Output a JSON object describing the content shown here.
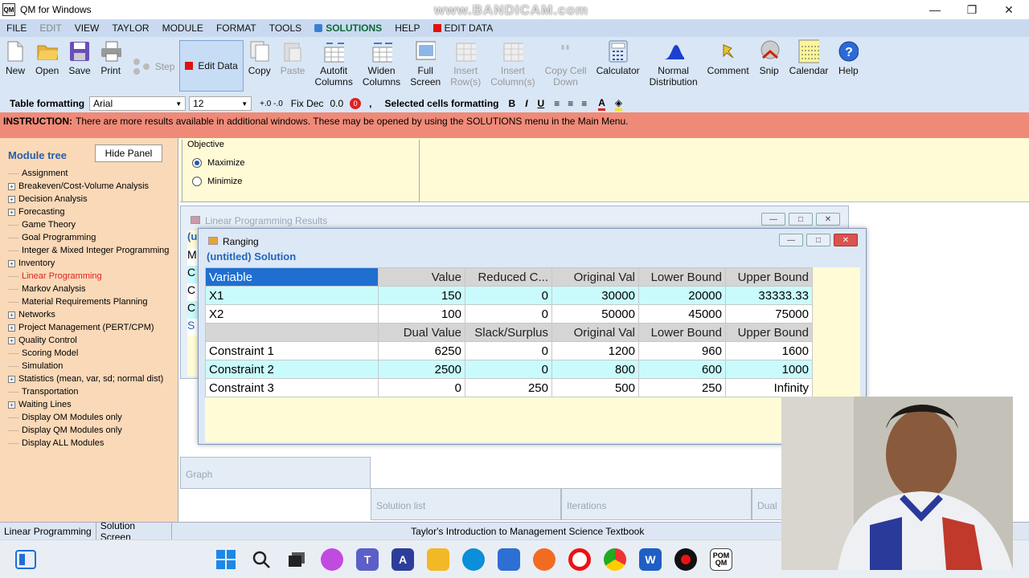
{
  "window": {
    "app_icon": "QM",
    "title": "QM for Windows",
    "watermark": "www.BANDICAM.com"
  },
  "menu": [
    "FILE",
    "EDIT",
    "VIEW",
    "TAYLOR",
    "MODULE",
    "FORMAT",
    "TOOLS",
    "SOLUTIONS",
    "HELP",
    "EDIT DATA"
  ],
  "toolbar": {
    "new": "New",
    "open": "Open",
    "save": "Save",
    "print": "Print",
    "step": "Step",
    "edit_data": "Edit Data",
    "copy": "Copy",
    "paste": "Paste",
    "autofit_1": "Autofit",
    "autofit_2": "Columns",
    "widen_1": "Widen",
    "widen_2": "Columns",
    "full_1": "Full",
    "full_2": "Screen",
    "insrow_1": "Insert",
    "insrow_2": "Row(s)",
    "inscol_1": "Insert",
    "inscol_2": "Column(s)",
    "copycell_1": "Copy Cell",
    "copycell_2": "Down",
    "calculator": "Calculator",
    "normal_1": "Normal",
    "normal_2": "Distribution",
    "comment": "Comment",
    "snip": "Snip",
    "calendar": "Calendar",
    "help": "Help"
  },
  "format": {
    "table_label": "Table formatting",
    "font": "Arial",
    "size": "12",
    "fixdec": "Fix Dec",
    "dec": "0.0",
    "comma": ",",
    "selected_label": "Selected cells formatting",
    "bold": "B",
    "italic": "I",
    "underline": "U"
  },
  "instruction": {
    "label": "INSTRUCTION:",
    "text": "There are more results available in additional windows. These may be opened by using the SOLUTIONS menu in the Main Menu."
  },
  "panel": {
    "title": "Module tree",
    "hide": "Hide Panel",
    "items": [
      {
        "label": "Assignment",
        "exp": false
      },
      {
        "label": "Breakeven/Cost-Volume Analysis",
        "exp": true
      },
      {
        "label": "Decision Analysis",
        "exp": true
      },
      {
        "label": "Forecasting",
        "exp": true
      },
      {
        "label": "Game Theory",
        "exp": false
      },
      {
        "label": "Goal Programming",
        "exp": false
      },
      {
        "label": "Integer & Mixed Integer Programming",
        "exp": false
      },
      {
        "label": "Inventory",
        "exp": true
      },
      {
        "label": "Linear Programming",
        "exp": false,
        "active": true
      },
      {
        "label": "Markov Analysis",
        "exp": false
      },
      {
        "label": "Material Requirements Planning",
        "exp": false
      },
      {
        "label": "Networks",
        "exp": true
      },
      {
        "label": "Project Management (PERT/CPM)",
        "exp": true
      },
      {
        "label": "Quality Control",
        "exp": true
      },
      {
        "label": "Scoring Model",
        "exp": false
      },
      {
        "label": "Simulation",
        "exp": false
      },
      {
        "label": "Statistics (mean, var, sd; normal dist)",
        "exp": true
      },
      {
        "label": "Transportation",
        "exp": false
      },
      {
        "label": "Waiting Lines",
        "exp": true
      },
      {
        "label": "Display OM Modules only",
        "exp": false
      },
      {
        "label": "Display QM Modules only",
        "exp": false
      },
      {
        "label": "Display ALL Modules",
        "exp": false
      }
    ]
  },
  "objective": {
    "legend": "Objective",
    "maximize": "Maximize",
    "minimize": "Minimize"
  },
  "lp_results": {
    "title": "Linear Programming Results",
    "side": [
      "(u",
      "M",
      "C",
      "C",
      "C",
      "S"
    ]
  },
  "ranging": {
    "title": "Ranging",
    "subtitle": "(untitled) Solution",
    "rows": [
      {
        "style": "hdr",
        "cells": [
          "Variable",
          "Value",
          "Reduced C...",
          "Original Val",
          "Lower Bound",
          "Upper Bound"
        ]
      },
      {
        "style": "cy",
        "cells": [
          "X1",
          "150",
          "0",
          "30000",
          "20000",
          "33333.33"
        ]
      },
      {
        "style": "wh",
        "cells": [
          "X2",
          "100",
          "0",
          "50000",
          "45000",
          "75000"
        ]
      },
      {
        "style": "hdr",
        "cells": [
          "",
          "Dual Value",
          "Slack/Surplus",
          "Original Val",
          "Lower Bound",
          "Upper Bound"
        ]
      },
      {
        "style": "wh",
        "cells": [
          "Constraint 1",
          "6250",
          "0",
          "1200",
          "960",
          "1600"
        ]
      },
      {
        "style": "cy",
        "cells": [
          "Constraint 2",
          "2500",
          "0",
          "800",
          "600",
          "1000"
        ]
      },
      {
        "style": "wh",
        "cells": [
          "Constraint 3",
          "0",
          "250",
          "500",
          "250",
          "Infinity"
        ]
      }
    ]
  },
  "tabs": {
    "graph": "Graph",
    "solution_list": "Solution list",
    "iterations": "Iterations",
    "dual": "Dual"
  },
  "status": {
    "module": "Linear Programming",
    "screen": "Solution Screen",
    "book": "Taylor's Introduction to Management Science Textbook"
  },
  "taskbar": {
    "pom": "POM QM"
  }
}
